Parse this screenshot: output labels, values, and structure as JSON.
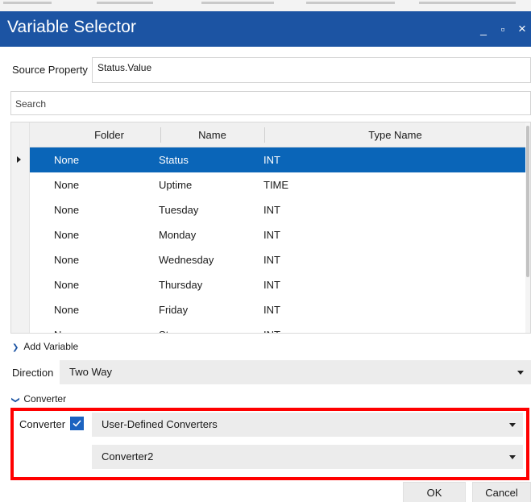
{
  "window": {
    "title": "Variable Selector",
    "minimize_glyph": "_",
    "maximize_glyph": "▫",
    "close_glyph": "×"
  },
  "source_property": {
    "label": "Source Property",
    "value": "Status.Value"
  },
  "search": {
    "placeholder": "Search"
  },
  "variables_grid": {
    "columns": [
      "Folder",
      "Name",
      "Type Name"
    ],
    "selected_index": 0,
    "rows": [
      {
        "folder": "None",
        "name": "Status",
        "type": "INT"
      },
      {
        "folder": "None",
        "name": "Uptime",
        "type": "TIME"
      },
      {
        "folder": "None",
        "name": "Tuesday",
        "type": "INT"
      },
      {
        "folder": "None",
        "name": "Monday",
        "type": "INT"
      },
      {
        "folder": "None",
        "name": "Wednesday",
        "type": "INT"
      },
      {
        "folder": "None",
        "name": "Thursday",
        "type": "INT"
      },
      {
        "folder": "None",
        "name": "Friday",
        "type": "INT"
      },
      {
        "folder": "None",
        "name": "Stop",
        "type": "INT"
      }
    ]
  },
  "add_variable": {
    "label": "Add Variable",
    "chevron_icon": "chevron-right-icon"
  },
  "direction": {
    "label": "Direction",
    "value": "Two Way"
  },
  "converter_section": {
    "header": "Converter",
    "chevron_icon": "chevron-down-icon",
    "checkbox_label": "Converter",
    "checked": true,
    "converter_type": "User-Defined Converters",
    "converter_name": "Converter2"
  },
  "buttons": {
    "ok": "OK",
    "cancel": "Cancel"
  },
  "colors": {
    "titlebar": "#1c54a3",
    "selected_row": "#0a65b8",
    "highlight_border": "#ff0000",
    "checkbox": "#1c63c0"
  }
}
